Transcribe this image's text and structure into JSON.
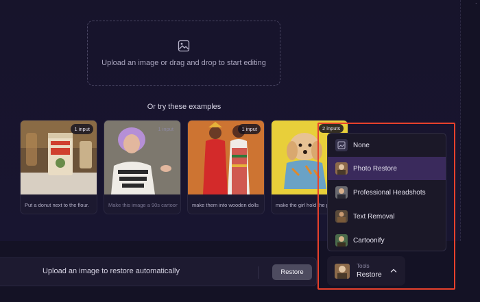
{
  "upload": {
    "prompt": "Upload an image or drag and drop to start editing",
    "icon": "image-icon"
  },
  "examples": {
    "title": "Or try these examples",
    "items": [
      {
        "badge": "1 input",
        "caption": "Put a donut next to the flour."
      },
      {
        "badge": "1 input",
        "caption": "Make this image a 90s cartoon"
      },
      {
        "badge": "1 input",
        "caption": "make them into wooden dolls"
      },
      {
        "badge": "2 inputs",
        "caption": "make the girl hold the p"
      }
    ]
  },
  "bottom_bar": {
    "hint": "Upload an image to restore automatically",
    "action_label": "Restore"
  },
  "tools": {
    "label": "Tools",
    "value": "Restore",
    "menu": [
      {
        "label": "None",
        "icon": "blank-image-icon",
        "active": false
      },
      {
        "label": "Photo Restore",
        "icon": "photo-restore-icon",
        "active": true
      },
      {
        "label": "Professional Headshots",
        "icon": "headshot-icon",
        "active": false
      },
      {
        "label": "Text Removal",
        "icon": "text-removal-icon",
        "active": false
      },
      {
        "label": "Cartoonify",
        "icon": "cartoonify-icon",
        "active": false
      }
    ]
  },
  "colors": {
    "background": "#141225",
    "active_item": "#3a2a5c",
    "highlight": "#e8412c"
  }
}
